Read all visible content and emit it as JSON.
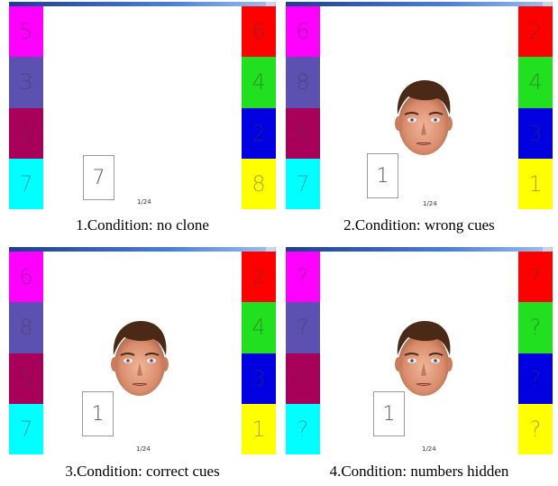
{
  "colors": {
    "magenta": "#ff00ff",
    "slate_blue": "#5c50b0",
    "crimson": "#a8005a",
    "cyan": "#00ffff",
    "red": "#ff0000",
    "green": "#20e020",
    "blue": "#0000e0",
    "yellow": "#ffff00"
  },
  "panels": [
    {
      "caption": "1.Condition: no clone",
      "left_tiles": [
        {
          "label": "5",
          "color": "#ff00ff"
        },
        {
          "label": "3",
          "color": "#5c50b0"
        },
        {
          "label": "1",
          "color": "#a8005a"
        },
        {
          "label": "7",
          "color": "#00ffff"
        }
      ],
      "right_tiles": [
        {
          "label": "6",
          "color": "#ff0000"
        },
        {
          "label": "4",
          "color": "#20e020"
        },
        {
          "label": "2",
          "color": "#0000e0"
        },
        {
          "label": "8",
          "color": "#ffff00"
        }
      ],
      "target_number": "7",
      "trial_counter": "1/24",
      "face_visible": false
    },
    {
      "caption": "2.Condition: wrong cues",
      "left_tiles": [
        {
          "label": "6",
          "color": "#ff00ff"
        },
        {
          "label": "8",
          "color": "#5c50b0"
        },
        {
          "label": "5",
          "color": "#a8005a"
        },
        {
          "label": "7",
          "color": "#00ffff"
        }
      ],
      "right_tiles": [
        {
          "label": "2",
          "color": "#ff0000"
        },
        {
          "label": "4",
          "color": "#20e020"
        },
        {
          "label": "3",
          "color": "#0000e0"
        },
        {
          "label": "1",
          "color": "#ffff00"
        }
      ],
      "target_number": "1",
      "trial_counter": "1/24",
      "face_visible": true
    },
    {
      "caption": "3.Condition: correct cues",
      "left_tiles": [
        {
          "label": "6",
          "color": "#ff00ff"
        },
        {
          "label": "8",
          "color": "#5c50b0"
        },
        {
          "label": "5",
          "color": "#a8005a"
        },
        {
          "label": "7",
          "color": "#00ffff"
        }
      ],
      "right_tiles": [
        {
          "label": "2",
          "color": "#ff0000"
        },
        {
          "label": "4",
          "color": "#20e020"
        },
        {
          "label": "3",
          "color": "#0000e0"
        },
        {
          "label": "1",
          "color": "#ffff00"
        }
      ],
      "target_number": "1",
      "trial_counter": "1/24",
      "face_visible": true
    },
    {
      "caption": "4.Condition: numbers hidden",
      "left_tiles": [
        {
          "label": "?",
          "color": "#ff00ff"
        },
        {
          "label": "?",
          "color": "#5c50b0"
        },
        {
          "label": "?",
          "color": "#a8005a"
        },
        {
          "label": "?",
          "color": "#00ffff"
        }
      ],
      "right_tiles": [
        {
          "label": "?",
          "color": "#ff0000"
        },
        {
          "label": "?",
          "color": "#20e020"
        },
        {
          "label": "?",
          "color": "#0000e0"
        },
        {
          "label": "?",
          "color": "#ffff00"
        }
      ],
      "target_number": "1",
      "trial_counter": "1/24",
      "face_visible": true
    }
  ]
}
